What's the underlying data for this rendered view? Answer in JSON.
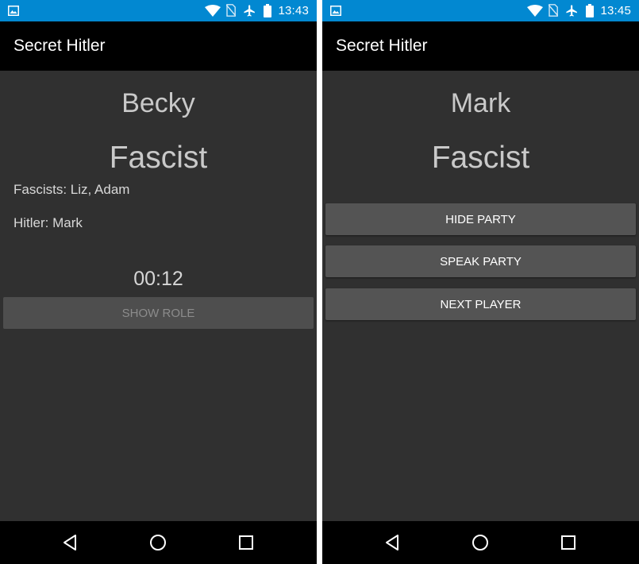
{
  "left": {
    "status_time": "13:43",
    "app_title": "Secret Hitler",
    "player_name": "Becky",
    "party": "Fascist",
    "fascists_line": "Fascists: Liz, Adam",
    "hitler_line": "Hitler: Mark",
    "timer": "00:12",
    "show_role_label": "SHOW ROLE"
  },
  "right": {
    "status_time": "13:45",
    "app_title": "Secret Hitler",
    "player_name": "Mark",
    "party": "Fascist",
    "hide_party_label": "HIDE PARTY",
    "speak_party_label": "SPEAK PARTY",
    "next_player_label": "NEXT PLAYER"
  },
  "status_icons": [
    "gallery-icon",
    "wifi-icon",
    "no-sim-icon",
    "airplane-mode-icon",
    "battery-icon"
  ],
  "nav_icons": [
    "back-icon",
    "home-icon",
    "recent-apps-icon"
  ],
  "colors": {
    "status_bar": "#0288d1",
    "app_bar": "#000000",
    "background": "#303030",
    "button": "#545454"
  }
}
